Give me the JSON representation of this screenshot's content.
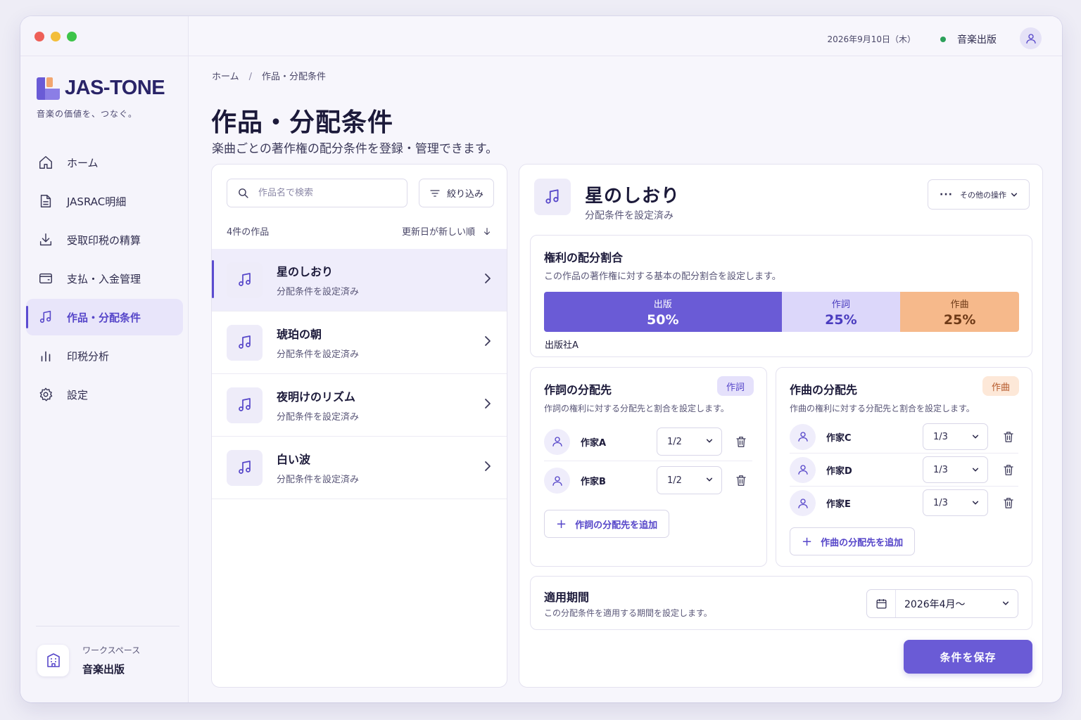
{
  "brand": {
    "name": "JAS-TONE",
    "tagline": "音楽の価値を、つなぐ。",
    "colors": {
      "accent": "#6a5bd6",
      "light_accent": "#dcd7fa",
      "orange": "#f6b98b",
      "status_green": "#2ca05a"
    }
  },
  "window": {
    "controls": [
      "close",
      "minimize",
      "maximize"
    ]
  },
  "sidebar": {
    "items": [
      {
        "label": "ホーム",
        "icon": "home-icon"
      },
      {
        "label": "JASRAC明細",
        "icon": "document-icon"
      },
      {
        "label": "受取印税の精算",
        "icon": "download-icon"
      },
      {
        "label": "支払・入金管理",
        "icon": "wallet-icon"
      },
      {
        "label": "作品・分配条件",
        "icon": "music-note-icon",
        "active": true
      },
      {
        "label": "印税分析",
        "icon": "bar-chart-icon"
      },
      {
        "label": "設定",
        "icon": "gear-icon"
      }
    ],
    "workspace": {
      "label": "ワークスペース",
      "name": "音楽出版",
      "icon": "building-icon"
    }
  },
  "topbar": {
    "date": "2026年9月10日（木）",
    "org": "音楽出版",
    "user_icon": "user-icon"
  },
  "breadcrumb": {
    "home": "ホーム",
    "sep": "/",
    "current": "作品・分配条件"
  },
  "page": {
    "title": "作品・分配条件",
    "subtitle": "楽曲ごとの著作権の配分条件を登録・管理できます。"
  },
  "list": {
    "search_placeholder": "作品名で検索",
    "filter_label": "絞り込み",
    "count": "4件の作品",
    "sort": "更新日が新しい順",
    "works": [
      {
        "title": "星のしおり",
        "status": "分配条件を設定済み",
        "active": true
      },
      {
        "title": "琥珀の朝",
        "status": "分配条件を設定済み"
      },
      {
        "title": "夜明けのリズム",
        "status": "分配条件を設定済み"
      },
      {
        "title": "白い波",
        "status": "分配条件を設定済み"
      }
    ]
  },
  "detail": {
    "title": "星のしおり",
    "status": "分配条件を設定済み",
    "more_label": "その他の操作",
    "ratio": {
      "title": "権利の配分割合",
      "desc": "この作品の著作権に対する基本の配分割合を設定します。",
      "segments": [
        {
          "label": "出版",
          "value": "50%",
          "share": 50
        },
        {
          "label": "作詞",
          "value": "25%",
          "share": 25
        },
        {
          "label": "作曲",
          "value": "25%",
          "share": 25
        }
      ],
      "publisher": "出版社A"
    },
    "lyrics": {
      "title": "作詞の分配先",
      "tag": "作詞",
      "desc": "作詞の権利に対する分配先と割合を設定します。",
      "rows": [
        {
          "name": "作家A",
          "share": "1/2"
        },
        {
          "name": "作家B",
          "share": "1/2"
        }
      ],
      "add_label": "作詞の分配先を追加"
    },
    "composition": {
      "title": "作曲の分配先",
      "tag": "作曲",
      "desc": "作曲の権利に対する分配先と割合を設定します。",
      "rows": [
        {
          "name": "作家C",
          "share": "1/3"
        },
        {
          "name": "作家D",
          "share": "1/3"
        },
        {
          "name": "作家E",
          "share": "1/3"
        }
      ],
      "add_label": "作曲の分配先を追加"
    },
    "period": {
      "title": "適用期間",
      "desc": "この分配条件を適用する期間を設定します。",
      "value": "2026年4月～"
    },
    "save_label": "条件を保存"
  }
}
